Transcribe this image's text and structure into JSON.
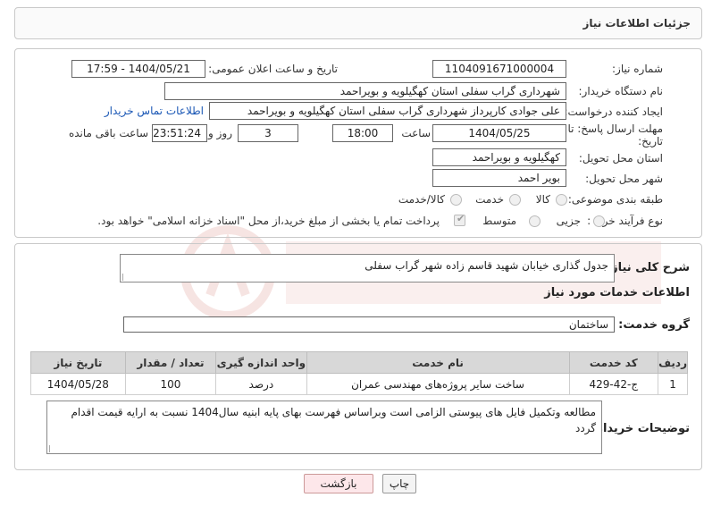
{
  "header": {
    "title": "جزئیات اطلاعات نیاز"
  },
  "need_number": {
    "label": "شماره نیاز:",
    "value": "1104091671000004"
  },
  "announce": {
    "label": "تاریخ و ساعت اعلان عمومی:",
    "value": "1404/05/21 - 17:59"
  },
  "buyer_org": {
    "label": "نام دستگاه خریدار:",
    "value": "شهرداری گراب سفلی استان کهگیلویه و بویراحمد"
  },
  "creator": {
    "label": "ایجاد کننده درخواست:",
    "value": "علی جوادی کارپرداز شهرداری گراب سفلی استان کهگیلویه و بویراحمد",
    "contact_link": "اطلاعات تماس خریدار"
  },
  "deadline": {
    "label_line1": "مهلت ارسال پاسخ: تا",
    "label_line2": "تاریخ:",
    "date": "1404/05/25",
    "time_label": "ساعت",
    "time": "18:00",
    "days": "3",
    "days_label": "روز و",
    "remaining": "23:51:24",
    "remaining_label": "ساعت باقی مانده"
  },
  "province": {
    "label": "استان محل تحویل:",
    "value": "کهگیلویه و بویراحمد"
  },
  "city": {
    "label": "شهر محل تحویل:",
    "value": "بویر احمد"
  },
  "category": {
    "label": "طبقه بندی موضوعی:",
    "options": [
      "کالا",
      "خدمت",
      "کالا/خدمت"
    ]
  },
  "process": {
    "label": "نوع فرآیند خرید :",
    "options": [
      "جزیی",
      "متوسط"
    ],
    "payment_note": "پرداخت تمام یا بخشی از مبلغ خرید،از محل \"اسناد خزانه اسلامی\" خواهد بود."
  },
  "summary": {
    "label": "شرح کلی نیاز:",
    "value": "جدول گذاری خیابان شهید قاسم زاده شهر گراب سفلی"
  },
  "services": {
    "section_title": "اطلاعات خدمات مورد نیاز",
    "group_label": "گروه خدمت:",
    "group_value": "ساختمان",
    "columns": [
      "ردیف",
      "کد خدمت",
      "نام خدمت",
      "واحد اندازه گیری",
      "تعداد / مقدار",
      "تاریخ نیاز"
    ],
    "rows": [
      {
        "row": "1",
        "code": "ج-42-429",
        "name": "ساخت سایر پروژه‌های مهندسی عمران",
        "unit": "درصد",
        "qty": "100",
        "date": "1404/05/28"
      }
    ]
  },
  "buyer_notes": {
    "label": "توضیحات خریدار:",
    "value": "مطالعه وتکمیل فایل های پیوستی الزامی است وبراساس فهرست بهای پایه ابنیه سال1404 نسبت به ارایه قیمت اقدام گردد"
  },
  "buttons": {
    "print": "چاپ",
    "back": "بازگشت"
  },
  "colors": {
    "link": "#1a57b5",
    "table_header": "#d8d8d8",
    "back_button": "#fde7ea"
  }
}
